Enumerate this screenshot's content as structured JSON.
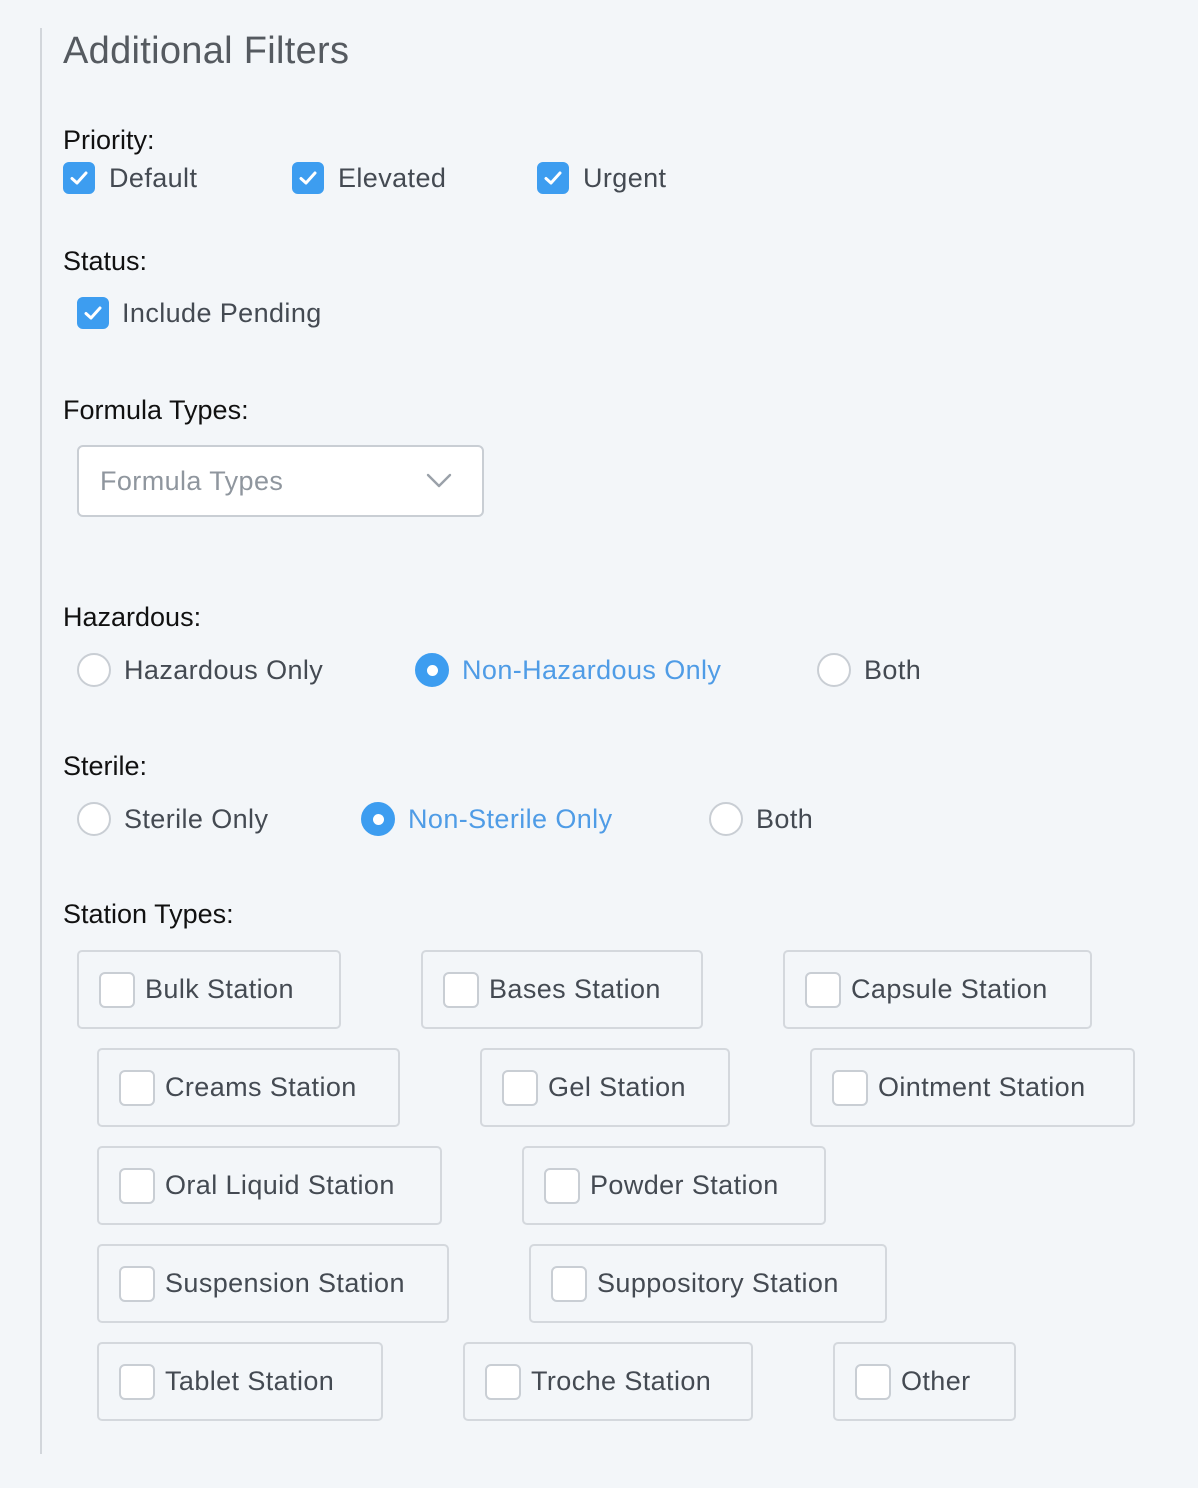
{
  "title": "Additional Filters",
  "priority": {
    "label": "Priority:",
    "options": [
      {
        "label": "Default",
        "checked": true
      },
      {
        "label": "Elevated",
        "checked": true
      },
      {
        "label": "Urgent",
        "checked": true
      }
    ]
  },
  "status": {
    "label": "Status:",
    "include_pending": {
      "label": "Include Pending",
      "checked": true
    }
  },
  "formula_types": {
    "label": "Formula Types:",
    "placeholder": "Formula Types"
  },
  "hazardous": {
    "label": "Hazardous:",
    "selected": "Non-Hazardous Only",
    "options": [
      "Hazardous Only",
      "Non-Hazardous Only",
      "Both"
    ]
  },
  "sterile": {
    "label": "Sterile:",
    "selected": "Non-Sterile Only",
    "options": [
      "Sterile Only",
      "Non-Sterile Only",
      "Both"
    ]
  },
  "station_types": {
    "label": "Station Types:",
    "items": [
      {
        "label": "Bulk Station",
        "checked": false
      },
      {
        "label": "Bases Station",
        "checked": false
      },
      {
        "label": "Capsule Station",
        "checked": false
      },
      {
        "label": "Creams Station",
        "checked": false
      },
      {
        "label": "Gel Station",
        "checked": false
      },
      {
        "label": "Ointment Station",
        "checked": false
      },
      {
        "label": "Oral Liquid Station",
        "checked": false
      },
      {
        "label": "Powder Station",
        "checked": false
      },
      {
        "label": "Suspension Station",
        "checked": false
      },
      {
        "label": "Suppository Station",
        "checked": false
      },
      {
        "label": "Tablet Station",
        "checked": false
      },
      {
        "label": "Troche Station",
        "checked": false
      },
      {
        "label": "Other",
        "checked": false
      }
    ]
  },
  "colors": {
    "accent": "#3d9df0",
    "background": "#f3f6f9",
    "selected_text": "#4f9ce6"
  }
}
